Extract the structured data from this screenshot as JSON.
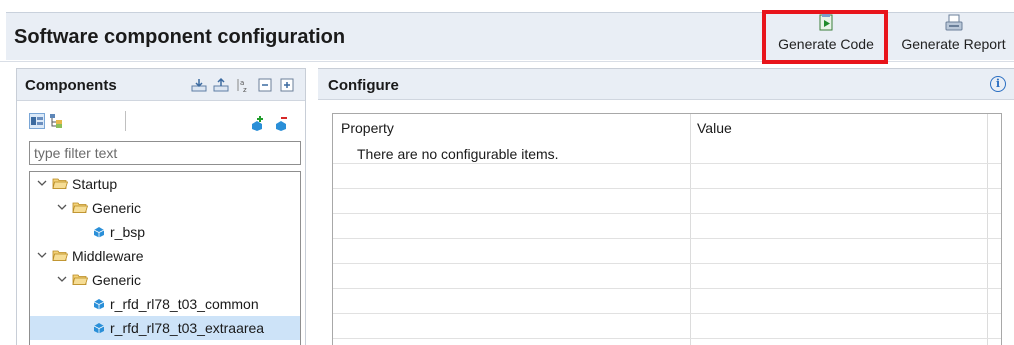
{
  "header": {
    "title": "Software component configuration",
    "generate_code_label": "Generate Code",
    "generate_report_label": "Generate Report"
  },
  "components_panel": {
    "title": "Components",
    "filter_placeholder": "type filter text",
    "tree": [
      {
        "label": "Startup",
        "level": 0,
        "type": "folder",
        "expanded": true
      },
      {
        "label": "Generic",
        "level": 1,
        "type": "folder",
        "expanded": true
      },
      {
        "label": "r_bsp",
        "level": 2,
        "type": "component"
      },
      {
        "label": "Middleware",
        "level": 0,
        "type": "folder",
        "expanded": true
      },
      {
        "label": "Generic",
        "level": 1,
        "type": "folder",
        "expanded": true
      },
      {
        "label": "r_rfd_rl78_t03_common",
        "level": 2,
        "type": "component"
      },
      {
        "label": "r_rfd_rl78_t03_extraarea",
        "level": 2,
        "type": "component",
        "selected": true
      }
    ]
  },
  "configure_panel": {
    "title": "Configure",
    "columns": [
      "Property",
      "Value"
    ],
    "empty_message": "There are no configurable items."
  },
  "colors": {
    "highlight": "#e8141b",
    "header_bg": "#e9eef5",
    "selection": "#cde3f8",
    "folder": "#e6b84a",
    "component": "#2a8fd8"
  }
}
